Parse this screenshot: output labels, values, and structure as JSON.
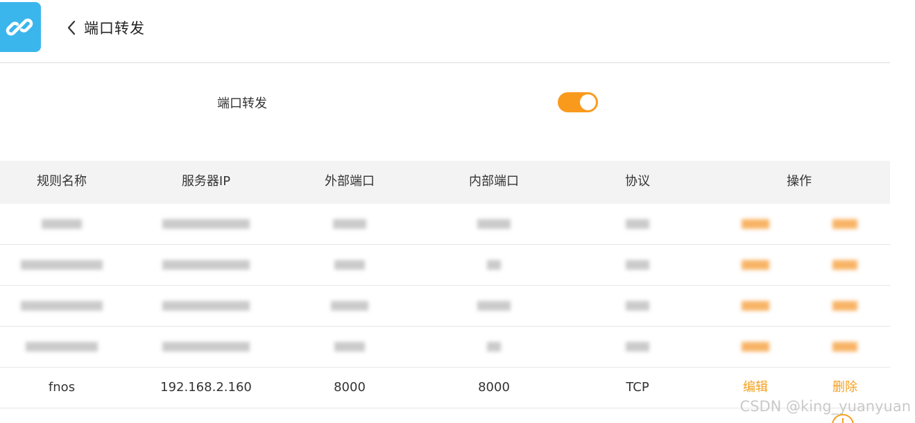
{
  "header": {
    "title": "端口转发"
  },
  "settings": {
    "toggle_label": "端口转发",
    "toggle_enabled": true
  },
  "table": {
    "columns": [
      "规则名称",
      "服务器IP",
      "外部端口",
      "内部端口",
      "协议",
      "操作"
    ],
    "rows": [
      {
        "name": "fnos",
        "ip": "192.168.2.160",
        "external_port": "8000",
        "internal_port": "8000",
        "protocol": "TCP",
        "edit": "编辑",
        "delete": "删除"
      }
    ]
  },
  "watermark": "CSDN @king_yuanyuan",
  "colors": {
    "accent": "#fa9a1d",
    "action_text": "#f5a020",
    "app_icon": "#3bb6ec",
    "header_bg": "#f3f3f3"
  },
  "icons": {
    "app": "link-icon",
    "back": "chevron-left-icon",
    "add": "add-circle-icon"
  }
}
